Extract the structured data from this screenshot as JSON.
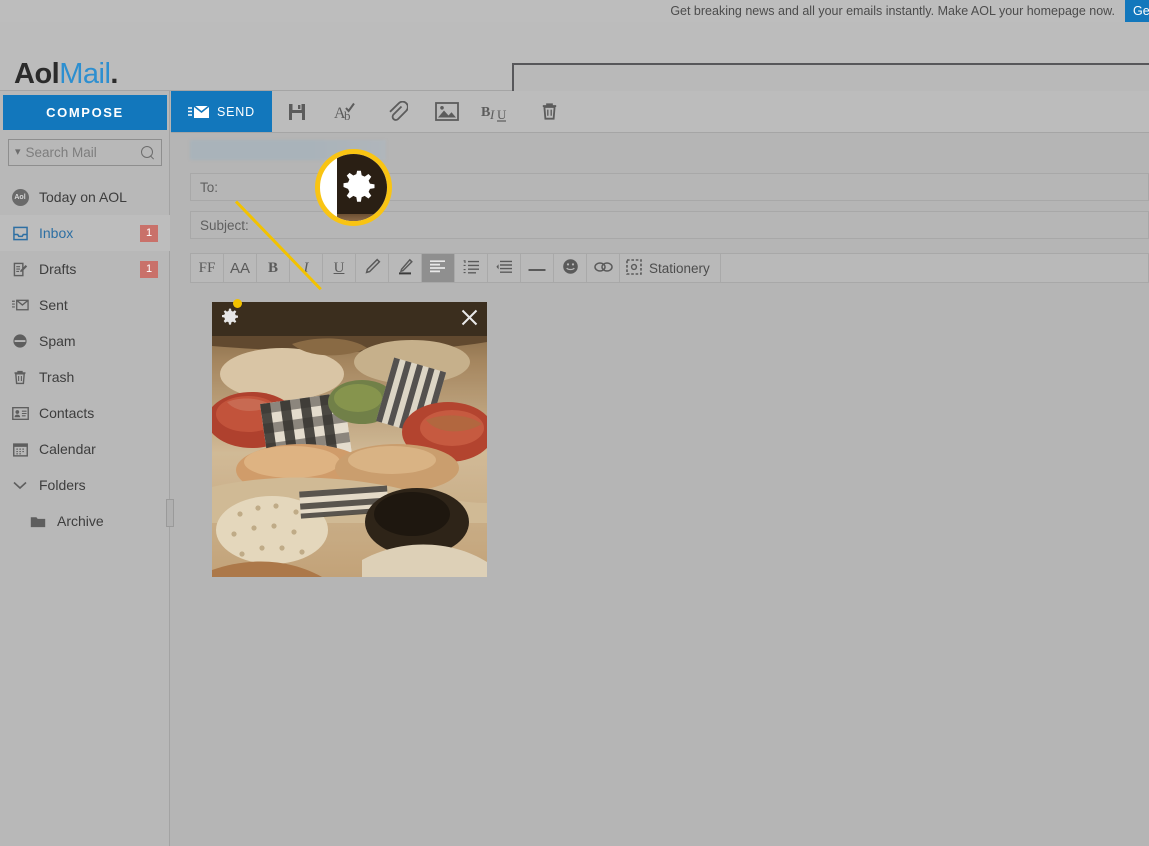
{
  "promo": {
    "text": "Get breaking news and all your emails instantly. Make AOL your homepage now.",
    "button_label": "Ge",
    "button_color": "#1277bc"
  },
  "header": {
    "logo_aol": "Aol",
    "logo_mail": "Mail",
    "logo_dot": ".",
    "search_value": "",
    "search_placeholder": ""
  },
  "sidebar": {
    "compose_label": "COMPOSE",
    "search": {
      "placeholder": "Search Mail",
      "chevron_icon": "chevron-down-icon",
      "search_icon": "search-icon"
    },
    "items": [
      {
        "label": "Today on AOL",
        "icon": "aol-circle-icon",
        "badge": "",
        "active": false
      },
      {
        "label": "Inbox",
        "icon": "inbox-tray-icon",
        "badge": "1",
        "active": true
      },
      {
        "label": "Drafts",
        "icon": "drafts-pencil-icon",
        "badge": "1",
        "active": false
      },
      {
        "label": "Sent",
        "icon": "sent-envelope-icon",
        "badge": "",
        "active": false
      },
      {
        "label": "Spam",
        "icon": "spam-block-icon",
        "badge": "",
        "active": false
      },
      {
        "label": "Trash",
        "icon": "trash-icon",
        "badge": "",
        "active": false
      },
      {
        "label": "Contacts",
        "icon": "contacts-card-icon",
        "badge": "",
        "active": false
      },
      {
        "label": "Calendar",
        "icon": "calendar-icon",
        "badge": "",
        "active": false
      },
      {
        "label": "Folders",
        "icon": "chevron-down-icon",
        "badge": "",
        "active": false
      },
      {
        "label": "Archive",
        "icon": "folder-icon",
        "badge": "",
        "active": false
      }
    ],
    "badge_color": "#c9716a",
    "accent_color": "#1277bc"
  },
  "compose": {
    "toolbar": {
      "send_label": "SEND",
      "send_icon": "send-envelope-icon",
      "icons": [
        "save-floppy-icon",
        "spellcheck-icon",
        "attach-paperclip-icon",
        "insert-image-icon",
        "formatting-bu-icon",
        "delete-trash-icon"
      ]
    },
    "fields": {
      "from_value": "",
      "to_label": "To:",
      "to_value": "",
      "subject_label": "Subject:",
      "subject_value": ""
    },
    "format_bar": {
      "font_family_label": "FF",
      "font_size_label": "AA",
      "bold_label": "B",
      "italic_label": "I",
      "underline_label": "U",
      "text_color_icon": "pencil-color-icon",
      "highlight_icon": "highlighter-icon",
      "align_icon": "align-left-icon",
      "list_icon": "numbered-list-icon",
      "indent_icon": "indent-icon",
      "hr_icon": "horizontal-rule-icon",
      "emoji_icon": "smiley-icon",
      "link_icon": "link-chain-icon",
      "stationery_icon": "stationery-frame-icon",
      "stationery_label": "Stationery"
    },
    "attachment": {
      "gear_icon": "gear-icon",
      "close_icon": "close-icon",
      "alt": "photo of blankets quilts and pillows piled on a bed"
    }
  },
  "callout": {
    "magnifier_icon": "gear-icon",
    "highlight_color": "#f9c413"
  }
}
